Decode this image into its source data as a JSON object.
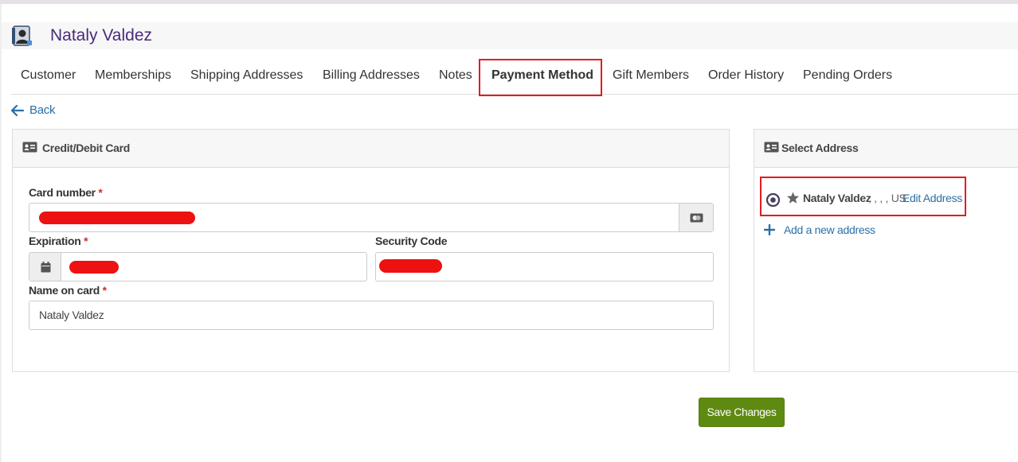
{
  "customer": {
    "name": "Nataly Valdez",
    "avatar_icon": "customer-card-icon"
  },
  "tabs": [
    {
      "label": "Customer",
      "active": false
    },
    {
      "label": "Memberships",
      "active": false
    },
    {
      "label": "Shipping Addresses",
      "active": false
    },
    {
      "label": "Billing Addresses",
      "active": false
    },
    {
      "label": "Notes",
      "active": false
    },
    {
      "label": "Payment Method",
      "active": true
    },
    {
      "label": "Gift Members",
      "active": false
    },
    {
      "label": "Order History",
      "active": false
    },
    {
      "label": "Pending Orders",
      "active": false
    }
  ],
  "back": {
    "label": "Back",
    "icon": "arrow-left-icon"
  },
  "card_panel": {
    "title": "Credit/Debit Card",
    "icon": "id-card-icon",
    "card_number": {
      "label": "Card number",
      "required": "*",
      "value_redacted": true,
      "addon_icon": "credit-card-icon"
    },
    "expiration": {
      "label": "Expiration",
      "required": "*",
      "value_redacted": true,
      "addon_icon": "calendar-icon"
    },
    "security_code": {
      "label": "Security Code",
      "value_redacted": true
    },
    "name_on_card": {
      "label": "Name on card",
      "required": "*",
      "value": "Nataly Valdez"
    }
  },
  "address_panel": {
    "title": "Select Address",
    "icon": "id-card-icon",
    "address": {
      "name": "Nataly Valdez",
      "details": ", , , , US",
      "edit_label": "Edit Address",
      "selected": true,
      "default_icon": "star-icon"
    },
    "add_new_label": "Add a new address"
  },
  "save_label": "Save Changes",
  "colors": {
    "brand_purple": "#4b2a7b",
    "link_blue": "#2a6fa6",
    "save_green": "#5f8a12",
    "highlight_red": "#e31b23",
    "required_red": "#c9302c"
  }
}
